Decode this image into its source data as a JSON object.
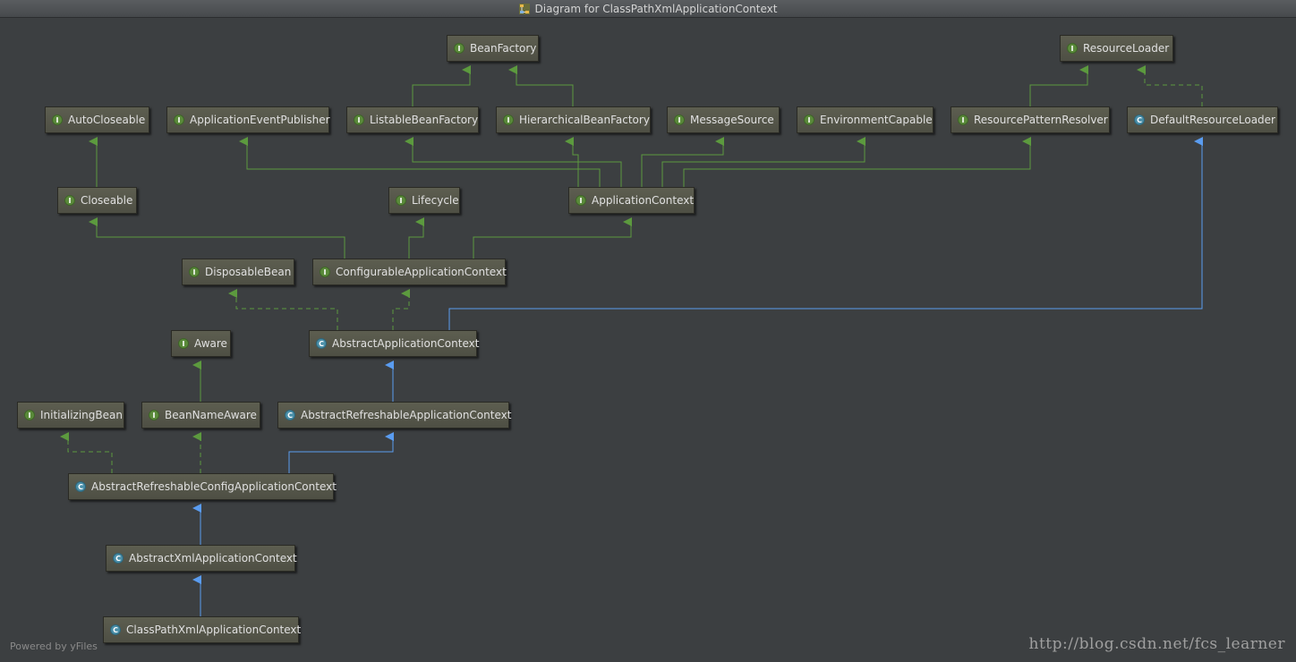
{
  "window": {
    "title": "Diagram for ClassPathXmlApplicationContext"
  },
  "colors": {
    "background": "#3c3f41",
    "extends_edge": "#5a9cf0",
    "implements_edge": "#5c9a3e",
    "interface_badge": "#5a8a3a",
    "class_badge": "#4a8fa8"
  },
  "nodes": {
    "bean_factory": {
      "label": "BeanFactory",
      "kind": "I"
    },
    "resource_loader": {
      "label": "ResourceLoader",
      "kind": "I"
    },
    "auto_closeable": {
      "label": "AutoCloseable",
      "kind": "I"
    },
    "application_event_publisher": {
      "label": "ApplicationEventPublisher",
      "kind": "I"
    },
    "listable_bean_factory": {
      "label": "ListableBeanFactory",
      "kind": "I"
    },
    "hierarchical_bean_factory": {
      "label": "HierarchicalBeanFactory",
      "kind": "I"
    },
    "message_source": {
      "label": "MessageSource",
      "kind": "I"
    },
    "environment_capable": {
      "label": "EnvironmentCapable",
      "kind": "I"
    },
    "resource_pattern_resolver": {
      "label": "ResourcePatternResolver",
      "kind": "I"
    },
    "default_resource_loader": {
      "label": "DefaultResourceLoader",
      "kind": "C"
    },
    "closeable": {
      "label": "Closeable",
      "kind": "I"
    },
    "lifecycle": {
      "label": "Lifecycle",
      "kind": "I"
    },
    "application_context": {
      "label": "ApplicationContext",
      "kind": "I"
    },
    "disposable_bean": {
      "label": "DisposableBean",
      "kind": "I"
    },
    "configurable_application_context": {
      "label": "ConfigurableApplicationContext",
      "kind": "I"
    },
    "aware": {
      "label": "Aware",
      "kind": "I"
    },
    "abstract_application_context": {
      "label": "AbstractApplicationContext",
      "kind": "C"
    },
    "initializing_bean": {
      "label": "InitializingBean",
      "kind": "I"
    },
    "bean_name_aware": {
      "label": "BeanNameAware",
      "kind": "I"
    },
    "abstract_refreshable_application_context": {
      "label": "AbstractRefreshableApplicationContext",
      "kind": "C"
    },
    "abstract_refreshable_config_application_context": {
      "label": "AbstractRefreshableConfigApplicationContext",
      "kind": "C"
    },
    "abstract_xml_application_context": {
      "label": "AbstractXmlApplicationContext",
      "kind": "C"
    },
    "class_path_xml_application_context": {
      "label": "ClassPathXmlApplicationContext",
      "kind": "C"
    }
  },
  "footer": {
    "powered_by": "Powered by yFiles",
    "watermark": "http://blog.csdn.net/fcs_learner"
  }
}
